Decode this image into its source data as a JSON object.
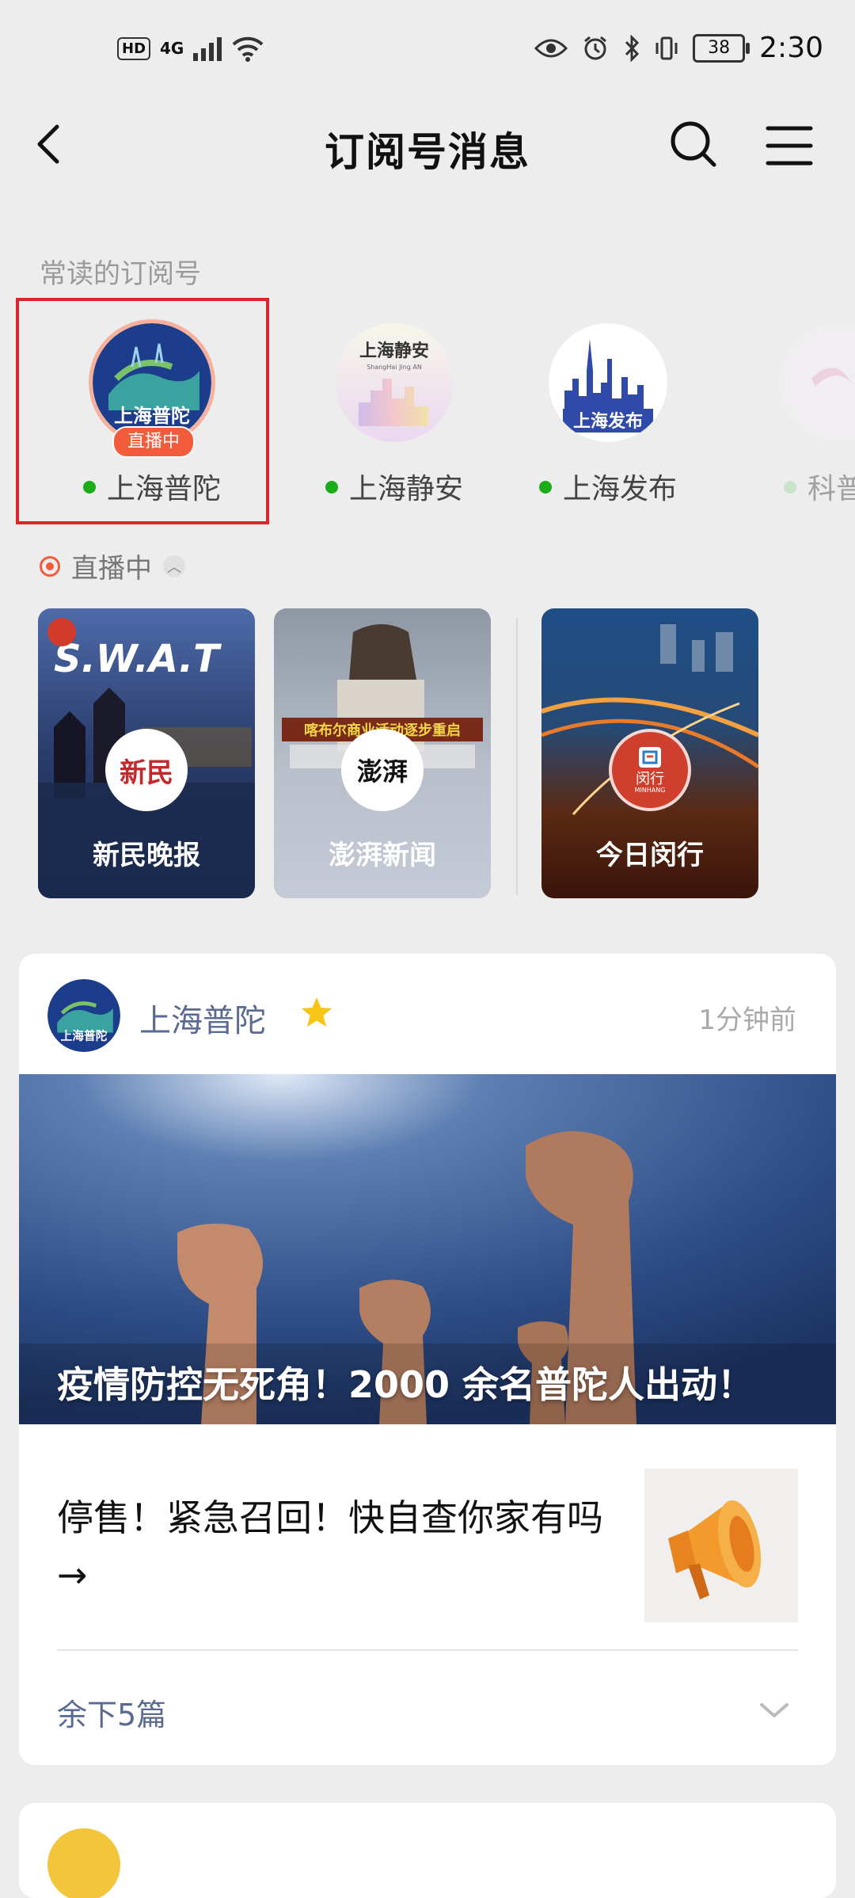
{
  "status_bar": {
    "network_badge": "HD",
    "signal_type": "4G",
    "wifi_tag": "4",
    "battery": "38",
    "time": "2:30"
  },
  "navbar": {
    "title": "订阅号消息"
  },
  "frequent": {
    "label": "常读的订阅号",
    "items": [
      {
        "name": "上海普陀",
        "live": "直播中",
        "logo_text": "上海普陀"
      },
      {
        "name": "上海静安",
        "logo_text": "上海静安",
        "logo_sub": "ShangHai Jing AN"
      },
      {
        "name": "上海发布",
        "logo_text": "上海发布"
      },
      {
        "name": "科普"
      }
    ]
  },
  "live_section": {
    "label": "直播中",
    "cards": [
      {
        "name": "新民晚报",
        "logo_text": "新民",
        "cover_text": "S.W.A.T"
      },
      {
        "name": "澎湃新闻",
        "logo_text": "澎湃",
        "cover_text": "喀布尔商业活动逐步重启"
      },
      {
        "name": "今日闵行",
        "logo_text": "闵行",
        "logo_sub": "MINHANG"
      }
    ]
  },
  "message_card": {
    "account": "上海普陀",
    "avatar_text": "上海普陀",
    "time": "1分钟前",
    "headline": "疫情防控无死角！2000 余名普陀人出动！",
    "sub_article": "停售！紧急召回！快自查你家有吗 →",
    "more": "余下5篇"
  },
  "colors": {
    "accent_red": "#d8262b",
    "live_orange": "#f25c3b",
    "link_blue": "#5b6a91",
    "online_green": "#1aad19",
    "star_yellow": "#f5c518"
  }
}
